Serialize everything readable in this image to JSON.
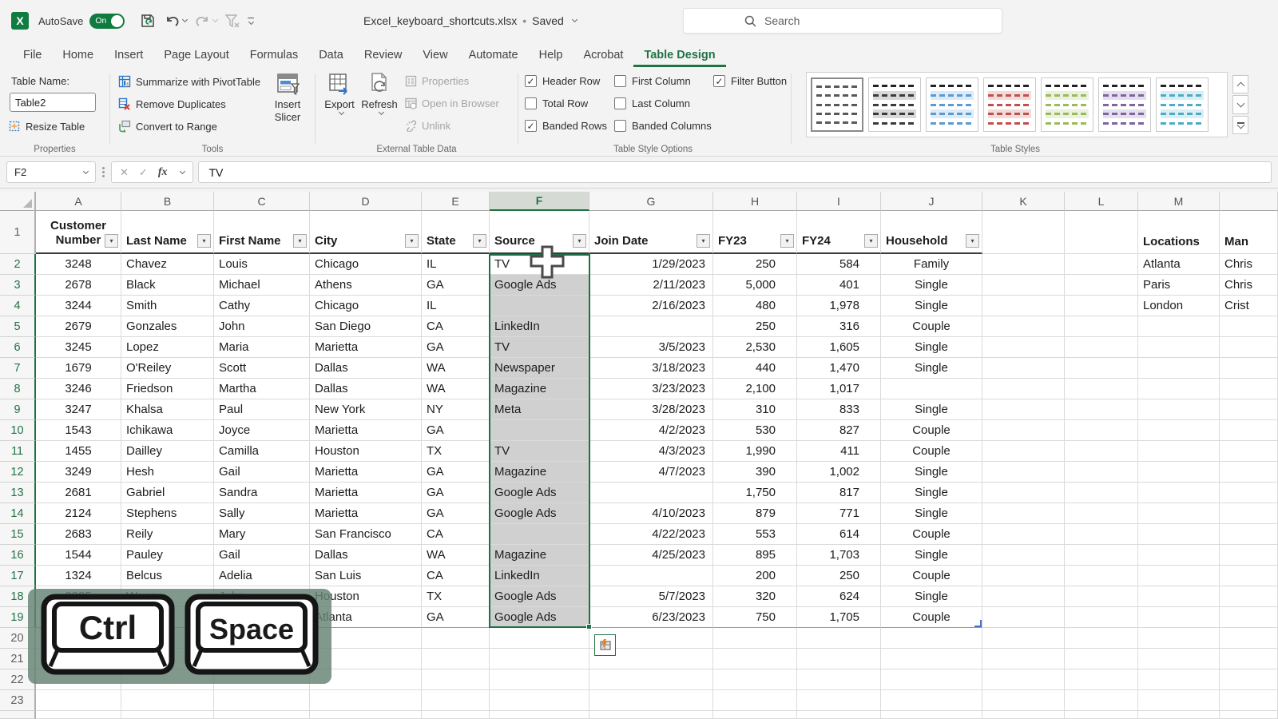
{
  "titlebar": {
    "app": "Excel",
    "autosave_label": "AutoSave",
    "autosave_state": "On",
    "filename": "Excel_keyboard_shortcuts.xlsx",
    "separator": "•",
    "saved_status": "Saved",
    "search_placeholder": "Search"
  },
  "menu": {
    "tabs": [
      "File",
      "Home",
      "Insert",
      "Page Layout",
      "Formulas",
      "Data",
      "Review",
      "View",
      "Automate",
      "Help",
      "Acrobat",
      "Table Design"
    ],
    "active_tab": "Table Design"
  },
  "ribbon": {
    "properties_group": {
      "label": "Properties",
      "table_name_label": "Table Name:",
      "table_name_value": "Table2",
      "resize_table_label": "Resize Table"
    },
    "tools_group": {
      "label": "Tools",
      "items": [
        {
          "label": "Summarize with PivotTable",
          "icon": "pivottable-icon"
        },
        {
          "label": "Remove Duplicates",
          "icon": "remove-duplicates-icon"
        },
        {
          "label": "Convert to Range",
          "icon": "convert-to-range-icon"
        }
      ],
      "insert_slicer_label": "Insert Slicer"
    },
    "external_group": {
      "label": "External Table Data",
      "export_label": "Export",
      "refresh_label": "Refresh",
      "disabled_items": [
        {
          "label": "Properties",
          "icon": "properties-icon"
        },
        {
          "label": "Open in Browser",
          "icon": "open-in-browser-icon"
        },
        {
          "label": "Unlink",
          "icon": "unlink-icon"
        }
      ]
    },
    "style_options_group": {
      "label": "Table Style Options",
      "checkboxes": [
        {
          "label": "Header Row",
          "checked": true,
          "col": 1
        },
        {
          "label": "Total Row",
          "checked": false,
          "col": 1
        },
        {
          "label": "Banded Rows",
          "checked": true,
          "col": 1
        },
        {
          "label": "First Column",
          "checked": false,
          "col": 2
        },
        {
          "label": "Last Column",
          "checked": false,
          "col": 2
        },
        {
          "label": "Banded Columns",
          "checked": false,
          "col": 2
        },
        {
          "label": "Filter Button",
          "checked": true,
          "col": 3
        }
      ]
    },
    "table_styles_group": {
      "label": "Table Styles",
      "swatches": [
        {
          "dash": "#595959",
          "band": "",
          "selected": true
        },
        {
          "dash": "#3b3b3b",
          "band": "#d9d9d9",
          "selected": false
        },
        {
          "dash": "#5b9bd5",
          "band": "#ddebf7",
          "selected": false
        },
        {
          "dash": "#c0504d",
          "band": "#f2dcdb",
          "selected": false
        },
        {
          "dash": "#9bbb59",
          "band": "#ebf1de",
          "selected": false
        },
        {
          "dash": "#8064a2",
          "band": "#e4dfec",
          "selected": false
        },
        {
          "dash": "#4bacc6",
          "band": "#daeef3",
          "selected": false
        }
      ]
    }
  },
  "formula_bar": {
    "name_box_value": "F2",
    "cancel_icon": "✕",
    "enter_icon": "✓",
    "fx_label": "fx",
    "formula_value": "TV"
  },
  "sheet": {
    "column_letters": [
      "A",
      "B",
      "C",
      "D",
      "E",
      "F",
      "G",
      "H",
      "I",
      "J",
      "K",
      "L",
      "M",
      ""
    ],
    "selected_column": "F",
    "active_cell": "F2",
    "table_headers": [
      "Customer Number",
      "Last Name",
      "First Name",
      "City",
      "State",
      "Source",
      "Join Date",
      "FY23",
      "FY24",
      "Household"
    ],
    "side_headers": {
      "m": "Locations",
      "n": "Man"
    },
    "filter_icon": "▾",
    "rows": [
      {
        "num": 2,
        "cells": [
          "3248",
          "Chavez",
          "Louis",
          "Chicago",
          "IL",
          "TV",
          "1/29/2023",
          "250",
          "584",
          "Family"
        ],
        "extra": [
          "Atlanta",
          "Chris"
        ]
      },
      {
        "num": 3,
        "cells": [
          "2678",
          "Black",
          "Michael",
          "Athens",
          "GA",
          "Google Ads",
          "2/11/2023",
          "5,000",
          "401",
          "Single"
        ],
        "extra": [
          "Paris",
          "Chris"
        ]
      },
      {
        "num": 4,
        "cells": [
          "3244",
          "Smith",
          "Cathy",
          "Chicago",
          "IL",
          "",
          "2/16/2023",
          "480",
          "1,978",
          "Single"
        ],
        "extra": [
          "London",
          "Crist"
        ]
      },
      {
        "num": 5,
        "cells": [
          "2679",
          "Gonzales",
          "John",
          "San Diego",
          "CA",
          "LinkedIn",
          "",
          "250",
          "316",
          "Couple"
        ]
      },
      {
        "num": 6,
        "cells": [
          "3245",
          "Lopez",
          "Maria",
          "Marietta",
          "GA",
          "TV",
          "3/5/2023",
          "2,530",
          "1,605",
          "Single"
        ]
      },
      {
        "num": 7,
        "cells": [
          "1679",
          "O'Reiley",
          "Scott",
          "Dallas",
          "WA",
          "Newspaper",
          "3/18/2023",
          "440",
          "1,470",
          "Single"
        ]
      },
      {
        "num": 8,
        "cells": [
          "3246",
          "Friedson",
          "Martha",
          "Dallas",
          "WA",
          "Magazine",
          "3/23/2023",
          "2,100",
          "1,017",
          ""
        ]
      },
      {
        "num": 9,
        "cells": [
          "3247",
          "Khalsa",
          "Paul",
          "New York",
          "NY",
          "Meta",
          "3/28/2023",
          "310",
          "833",
          "Single"
        ]
      },
      {
        "num": 10,
        "cells": [
          "1543",
          "Ichikawa",
          "Joyce",
          "Marietta",
          "GA",
          "",
          "4/2/2023",
          "530",
          "827",
          "Couple"
        ]
      },
      {
        "num": 11,
        "cells": [
          "1455",
          "Dailley",
          "Camilla",
          "Houston",
          "TX",
          "TV",
          "4/3/2023",
          "1,990",
          "411",
          "Couple"
        ]
      },
      {
        "num": 12,
        "cells": [
          "3249",
          "Hesh",
          "Gail",
          "Marietta",
          "GA",
          "Magazine",
          "4/7/2023",
          "390",
          "1,002",
          "Single"
        ]
      },
      {
        "num": 13,
        "cells": [
          "2681",
          "Gabriel",
          "Sandra",
          "Marietta",
          "GA",
          "Google Ads",
          "",
          "1,750",
          "817",
          "Single"
        ]
      },
      {
        "num": 14,
        "cells": [
          "2124",
          "Stephens",
          "Sally",
          "Marietta",
          "GA",
          "Google Ads",
          "4/10/2023",
          "879",
          "771",
          "Single"
        ]
      },
      {
        "num": 15,
        "cells": [
          "2683",
          "Reily",
          "Mary",
          "San Francisco",
          "CA",
          "",
          "4/22/2023",
          "553",
          "614",
          "Couple"
        ]
      },
      {
        "num": 16,
        "cells": [
          "1544",
          "Pauley",
          "Gail",
          "Dallas",
          "WA",
          "Magazine",
          "4/25/2023",
          "895",
          "1,703",
          "Single"
        ]
      },
      {
        "num": 17,
        "cells": [
          "1324",
          "Belcus",
          "Adelia",
          "San Luis",
          "CA",
          "LinkedIn",
          "",
          "200",
          "250",
          "Couple"
        ]
      },
      {
        "num": 18,
        "cells": [
          "2235",
          "Wong",
          "John",
          "Houston",
          "TX",
          "Google Ads",
          "5/7/2023",
          "320",
          "624",
          "Single"
        ]
      },
      {
        "num": 19,
        "cells": [
          "",
          "",
          "",
          "Atlanta",
          "GA",
          "Google Ads",
          "6/23/2023",
          "750",
          "1,705",
          "Couple"
        ]
      }
    ],
    "empty_row_nums": [
      20,
      21,
      22,
      23
    ]
  },
  "kbd_overlay": {
    "keys": [
      "Ctrl",
      "Space"
    ]
  },
  "colors": {
    "excel_green": "#217346",
    "selection_border": "#1E7145",
    "selection_fill": "#D0D0D0",
    "toggle_on": "#0F7B3F",
    "table_handle_blue": "#4472C4"
  }
}
